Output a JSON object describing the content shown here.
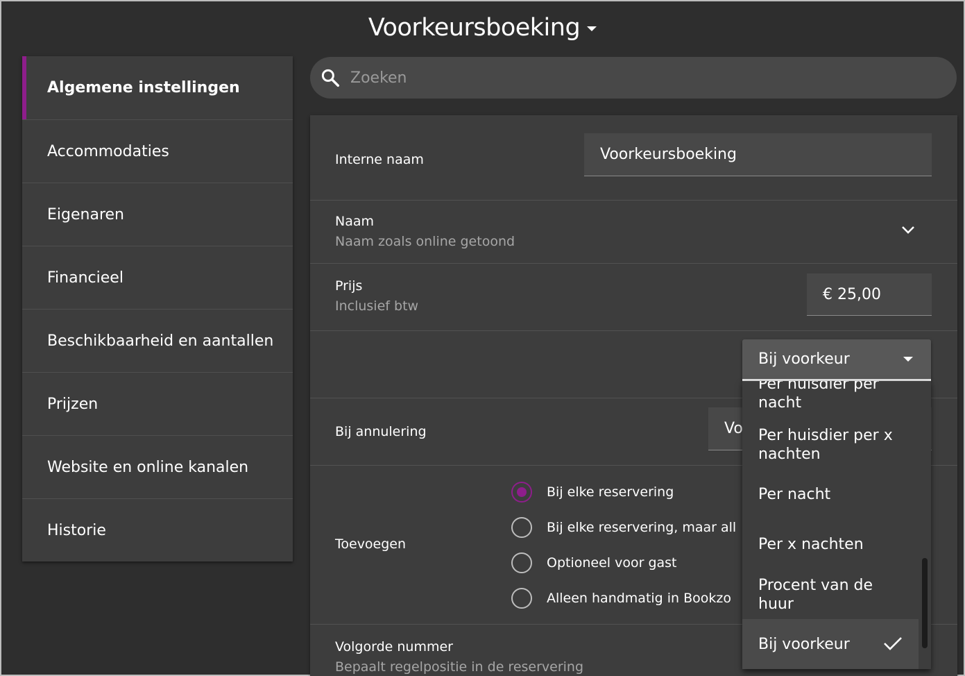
{
  "header": {
    "title": "Voorkeursboeking"
  },
  "sidebar": {
    "items": [
      {
        "label": "Algemene instellingen",
        "active": true
      },
      {
        "label": "Accommodaties"
      },
      {
        "label": "Eigenaren"
      },
      {
        "label": "Financieel"
      },
      {
        "label": "Beschikbaarheid en aantallen"
      },
      {
        "label": "Prijzen"
      },
      {
        "label": "Website en online kanalen"
      },
      {
        "label": "Historie"
      }
    ]
  },
  "search": {
    "placeholder": "Zoeken"
  },
  "form": {
    "internal_name": {
      "label": "Interne naam",
      "value": "Voorkeursboeking"
    },
    "name": {
      "label": "Naam",
      "sublabel": "Naam zoals online getoond"
    },
    "price": {
      "label": "Prijs",
      "sublabel": "Inclusief btw",
      "value": "€ 25,00"
    },
    "cancellation": {
      "label": "Bij annulering",
      "value_partial": "Vo"
    },
    "add": {
      "label": "Toevoegen",
      "options": [
        {
          "label": "Bij elke reservering",
          "checked": true
        },
        {
          "label": "Bij elke reservering, maar all"
        },
        {
          "label": "Optioneel voor gast"
        },
        {
          "label": "Alleen handmatig in Bookzo"
        }
      ]
    },
    "order": {
      "label": "Volgorde nummer",
      "sublabel": "Bepaalt regelpositie in de reservering"
    }
  },
  "dropdown": {
    "selected": "Bij voorkeur",
    "options": [
      {
        "line1": "Per huisdier per",
        "line2": "nacht"
      },
      {
        "line1": "Per huisdier per x",
        "line2": "nachten"
      },
      {
        "line1": "Per nacht"
      },
      {
        "line1": "Per x nachten"
      },
      {
        "line1": "Procent van de",
        "line2": "huur"
      },
      {
        "line1": "Bij voorkeur",
        "selected": true
      }
    ]
  },
  "colors": {
    "accent": "#8e1e8b",
    "background": "#2e2e2e",
    "panel": "#3d3d3d"
  }
}
